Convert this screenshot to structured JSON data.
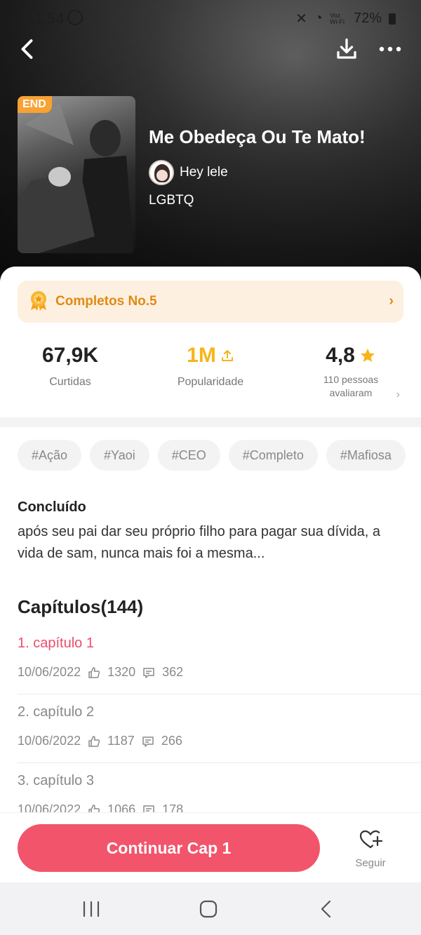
{
  "status_bar": {
    "time": "11:54",
    "volte": "Voz Wi-Fi",
    "battery": "72%"
  },
  "header": {
    "end_badge": "END",
    "title": "Me Obedeça Ou Te Mato!",
    "author": "Hey lele",
    "genre": "LGBTQ"
  },
  "rank": {
    "label": "Completos No.5",
    "accent": "#e08a14"
  },
  "stats": {
    "likes": {
      "value": "67,9K",
      "label": "Curtidas"
    },
    "popularity": {
      "value": "1M",
      "label": "Popularidade"
    },
    "rating": {
      "value": "4,8",
      "line1": "110 pessoas",
      "line2": "avaliaram"
    }
  },
  "tags": [
    "#Ação",
    "#Yaoi",
    "#CEO",
    "#Completo",
    "#Mafiosa"
  ],
  "description": {
    "status": "Concluído",
    "synopsis": "após seu pai dar seu próprio filho para pagar sua dívida, a vida de sam, nunca mais foi a mesma..."
  },
  "chapters": {
    "title": "Capítulos(144)",
    "items": [
      {
        "name": "1. capítulo 1",
        "date": "10/06/2022",
        "likes": "1320",
        "comments": "362"
      },
      {
        "name": "2. capítulo 2",
        "date": "10/06/2022",
        "likes": "1187",
        "comments": "266"
      },
      {
        "name": "3. capítulo 3",
        "date": "10/06/2022",
        "likes": "1066",
        "comments": "178"
      }
    ]
  },
  "actions": {
    "continue": "Continuar Cap 1",
    "follow": "Seguir"
  },
  "colors": {
    "primary": "#f2546b",
    "active_chapter": "#ee4d6a",
    "popularity": "#f7b41a",
    "badge": "#f7a233"
  }
}
